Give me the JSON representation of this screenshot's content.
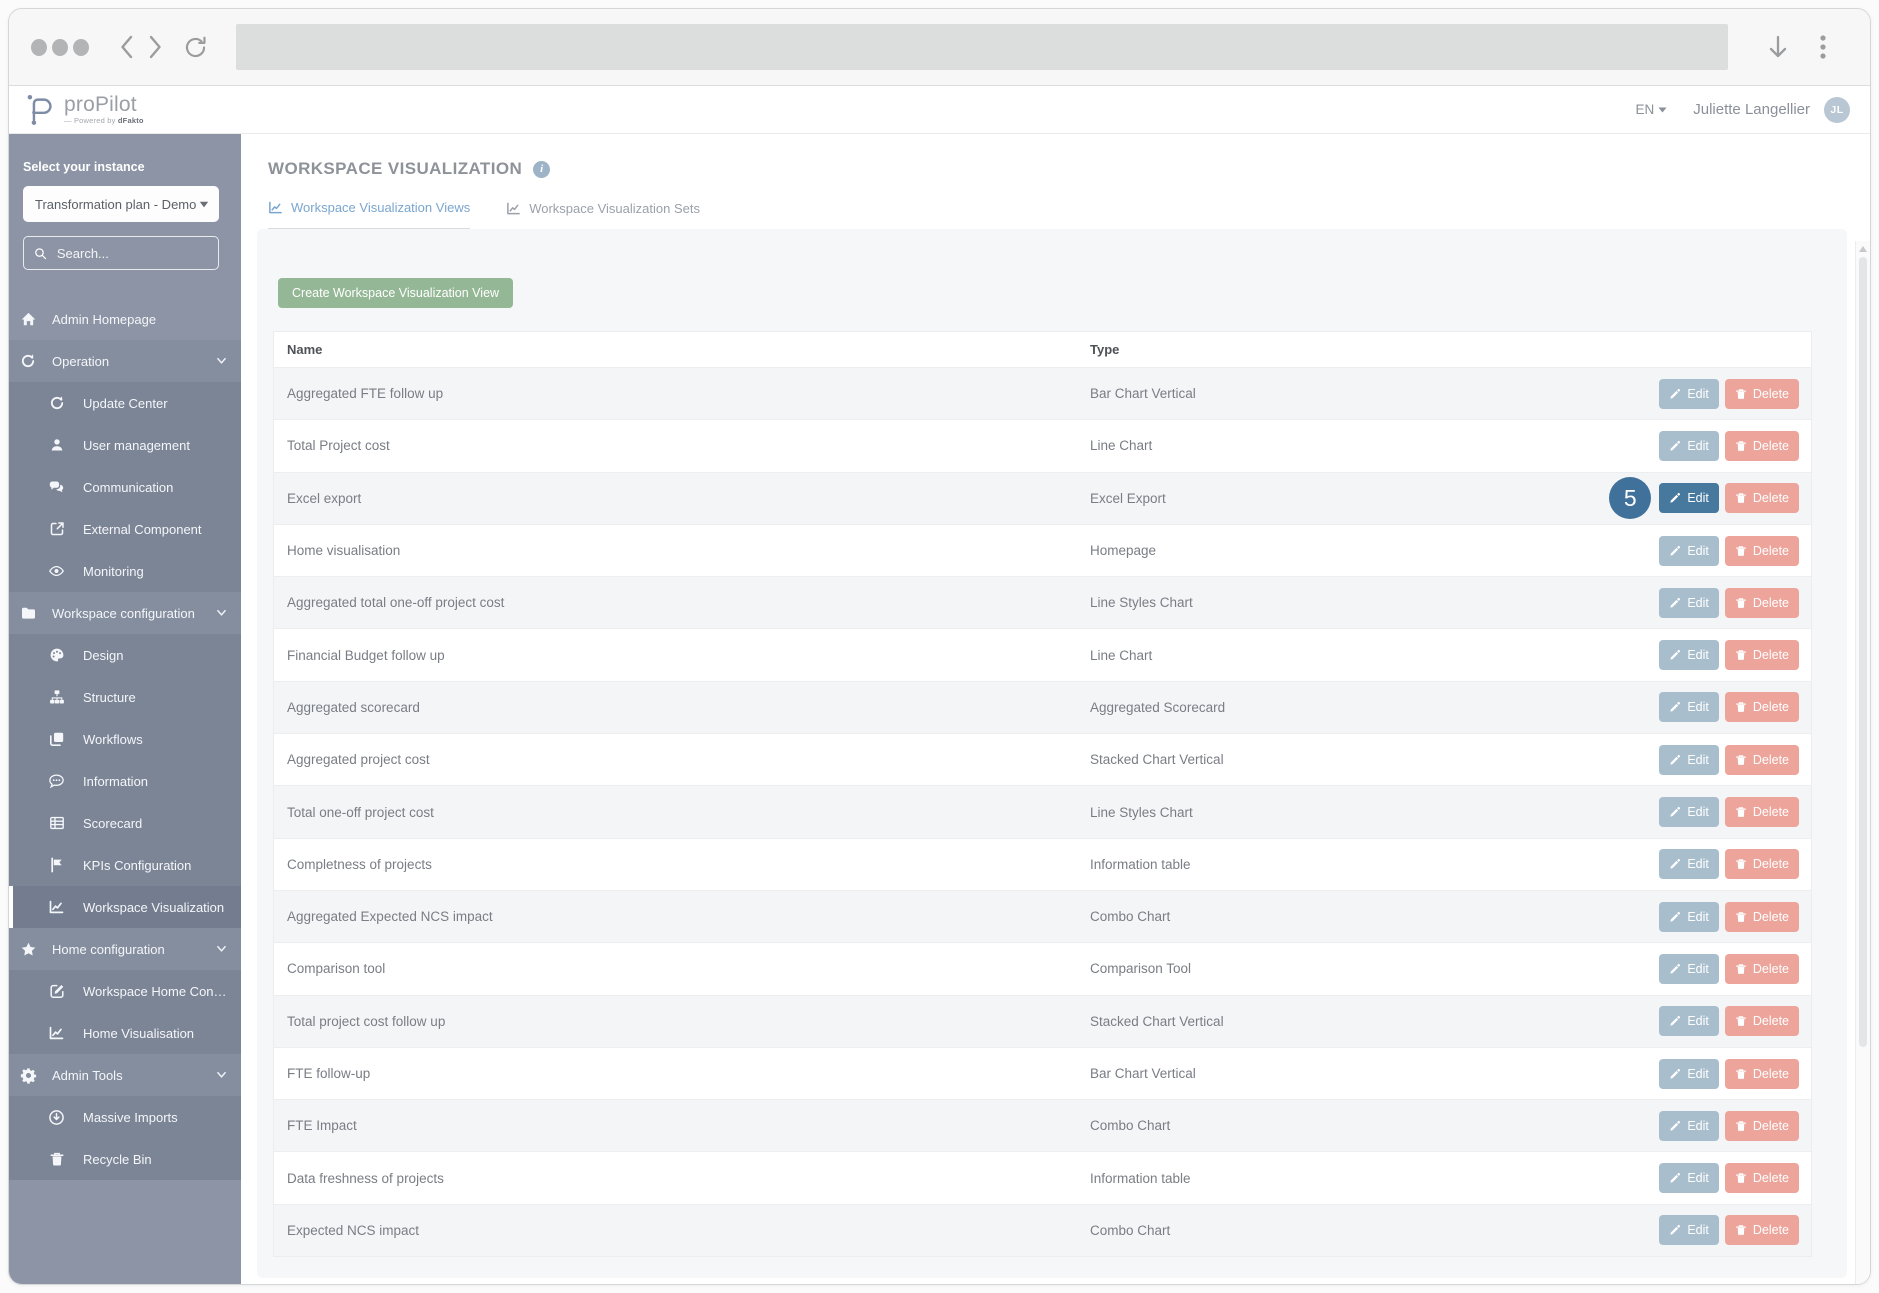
{
  "browser": {
    "address_bar_value": ""
  },
  "header": {
    "brand": "proPilot",
    "brand_tagline": "— Powered by",
    "brand_company": "dFakto",
    "language": "EN",
    "user_name": "Juliette Langellier",
    "avatar_initials": "JL"
  },
  "sidebar": {
    "instance_label": "Select your instance",
    "instance_value": "Transformation plan - Demo",
    "search_placeholder": "Search...",
    "items": [
      {
        "label": "Admin Homepage",
        "icon": "home",
        "kind": "top"
      },
      {
        "label": "Operation",
        "icon": "refresh",
        "kind": "group",
        "expanded": true
      },
      {
        "label": "Update Center",
        "icon": "refresh",
        "kind": "sub"
      },
      {
        "label": "User management",
        "icon": "user",
        "kind": "sub"
      },
      {
        "label": "Communication",
        "icon": "chat",
        "kind": "sub"
      },
      {
        "label": "External Component",
        "icon": "external",
        "kind": "sub"
      },
      {
        "label": "Monitoring",
        "icon": "eye",
        "kind": "sub"
      },
      {
        "label": "Workspace configuration",
        "icon": "folder",
        "kind": "group",
        "expanded": true
      },
      {
        "label": "Design",
        "icon": "palette",
        "kind": "sub"
      },
      {
        "label": "Structure",
        "icon": "sitemap",
        "kind": "sub"
      },
      {
        "label": "Workflows",
        "icon": "pages",
        "kind": "sub"
      },
      {
        "label": "Information",
        "icon": "comment",
        "kind": "sub"
      },
      {
        "label": "Scorecard",
        "icon": "grid",
        "kind": "sub"
      },
      {
        "label": "KPIs Configuration",
        "icon": "flag",
        "kind": "sub"
      },
      {
        "label": "Workspace Visualization",
        "icon": "chart",
        "kind": "sub",
        "active": true
      },
      {
        "label": "Home configuration",
        "icon": "star",
        "kind": "group",
        "expanded": true
      },
      {
        "label": "Workspace Home Conf...",
        "icon": "editsq",
        "kind": "sub"
      },
      {
        "label": "Home Visualisation",
        "icon": "chart",
        "kind": "sub"
      },
      {
        "label": "Admin Tools",
        "icon": "gear",
        "kind": "group",
        "expanded": true
      },
      {
        "label": "Massive Imports",
        "icon": "downloadc",
        "kind": "sub"
      },
      {
        "label": "Recycle Bin",
        "icon": "trash",
        "kind": "sub"
      }
    ]
  },
  "main": {
    "title": "WORKSPACE VISUALIZATION",
    "tabs": [
      {
        "label": "Workspace Visualization Views",
        "active": true
      },
      {
        "label": "Workspace Visualization Sets",
        "active": false
      }
    ],
    "create_button": "Create Workspace Visualization View",
    "table": {
      "columns": [
        "Name",
        "Type"
      ],
      "edit_label": "Edit",
      "delete_label": "Delete",
      "rows": [
        {
          "name": "Aggregated FTE follow up",
          "type": "Bar Chart Vertical"
        },
        {
          "name": "Total Project cost",
          "type": "Line Chart"
        },
        {
          "name": "Excel export",
          "type": "Excel Export",
          "highlighted": true,
          "badge": "5"
        },
        {
          "name": "Home visualisation",
          "type": "Homepage"
        },
        {
          "name": "Aggregated total one-off project cost",
          "type": "Line Styles Chart"
        },
        {
          "name": "Financial Budget follow up",
          "type": "Line Chart"
        },
        {
          "name": "Aggregated scorecard",
          "type": "Aggregated Scorecard"
        },
        {
          "name": "Aggregated project cost",
          "type": "Stacked Chart Vertical"
        },
        {
          "name": "Total one-off project cost",
          "type": "Line Styles Chart"
        },
        {
          "name": "Completness of projects",
          "type": "Information table"
        },
        {
          "name": "Aggregated Expected NCS impact",
          "type": "Combo Chart"
        },
        {
          "name": "Comparison tool",
          "type": "Comparison Tool"
        },
        {
          "name": "Total project cost follow up",
          "type": "Stacked Chart Vertical"
        },
        {
          "name": "FTE follow-up",
          "type": "Bar Chart Vertical"
        },
        {
          "name": "FTE Impact",
          "type": "Combo Chart"
        },
        {
          "name": "Data freshness of projects",
          "type": "Information table"
        },
        {
          "name": "Expected NCS impact",
          "type": "Combo Chart"
        }
      ]
    }
  },
  "colors": {
    "sidebar_bg": "#8C94A5",
    "sidebar_group_bg": "#858E9E",
    "sidebar_submenu_bg": "#7C8596",
    "sidebar_active_bg": "#737D8F",
    "accent_tab": "#7AA6CE",
    "create_button": "#94B795",
    "edit_button": "#A9BECD",
    "edit_button_active": "#47799F",
    "delete_button": "#ECA49B",
    "badge": "#40719B",
    "info_icon": "#9DB3C8",
    "avatar_bg": "#B9C6D3",
    "logo": "#7E8CA6"
  }
}
